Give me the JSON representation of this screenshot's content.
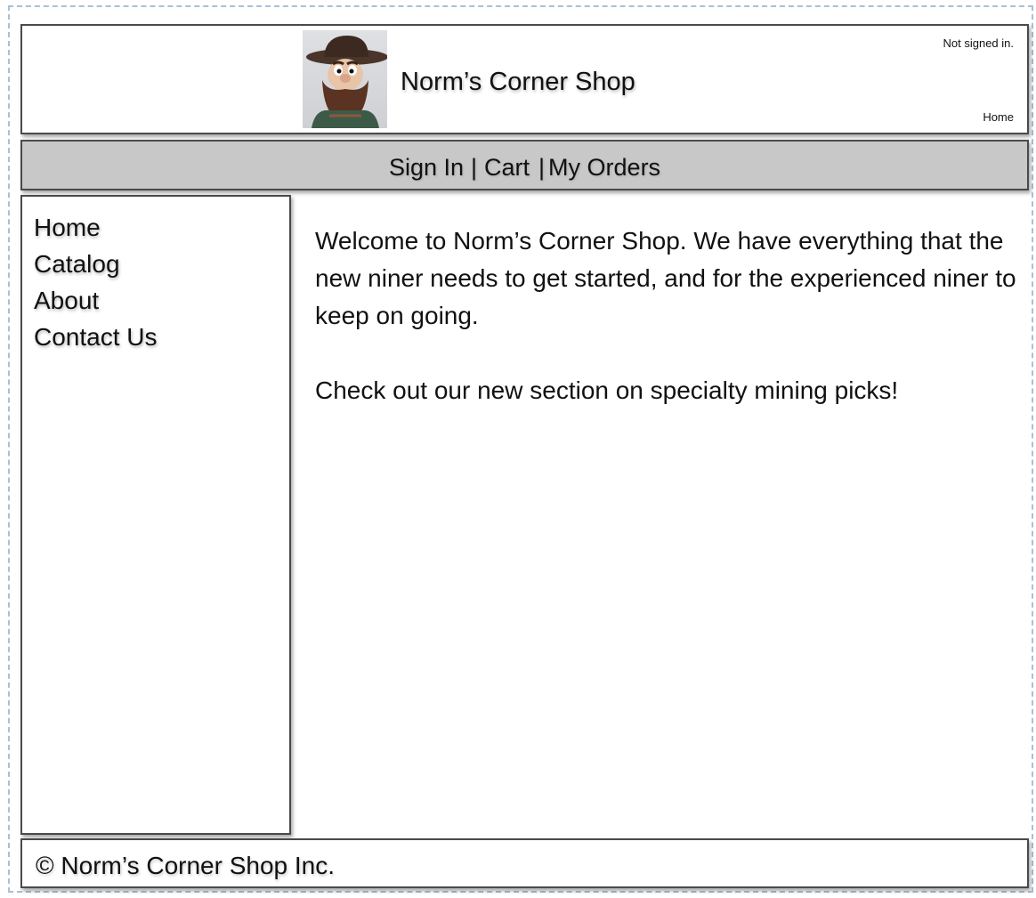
{
  "header": {
    "title": "Norm’s Corner Shop",
    "status": "Not signed in.",
    "breadcrumb": "Home",
    "logo_icon": "mascot-miner-icon"
  },
  "nav": {
    "sign_in": "Sign In",
    "cart": "Cart",
    "my_orders": "My Orders",
    "separator": "|"
  },
  "sidebar": {
    "items": [
      {
        "label": "Home"
      },
      {
        "label": "Catalog"
      },
      {
        "label": "About"
      },
      {
        "label": "Contact Us"
      }
    ]
  },
  "main": {
    "paragraphs": [
      "Welcome to Norm’s Corner Shop.  We have everything that the new niner needs to get started, and for the experienced niner to keep on going.",
      "Check out our new section on specialty mining picks!"
    ]
  },
  "footer": {
    "copyright": "© Norm’s Corner Shop Inc."
  },
  "colors": {
    "nav_background": "#c8c8c8",
    "border": "#4a4a4a",
    "frame_dashed": "#a9c0d8"
  }
}
